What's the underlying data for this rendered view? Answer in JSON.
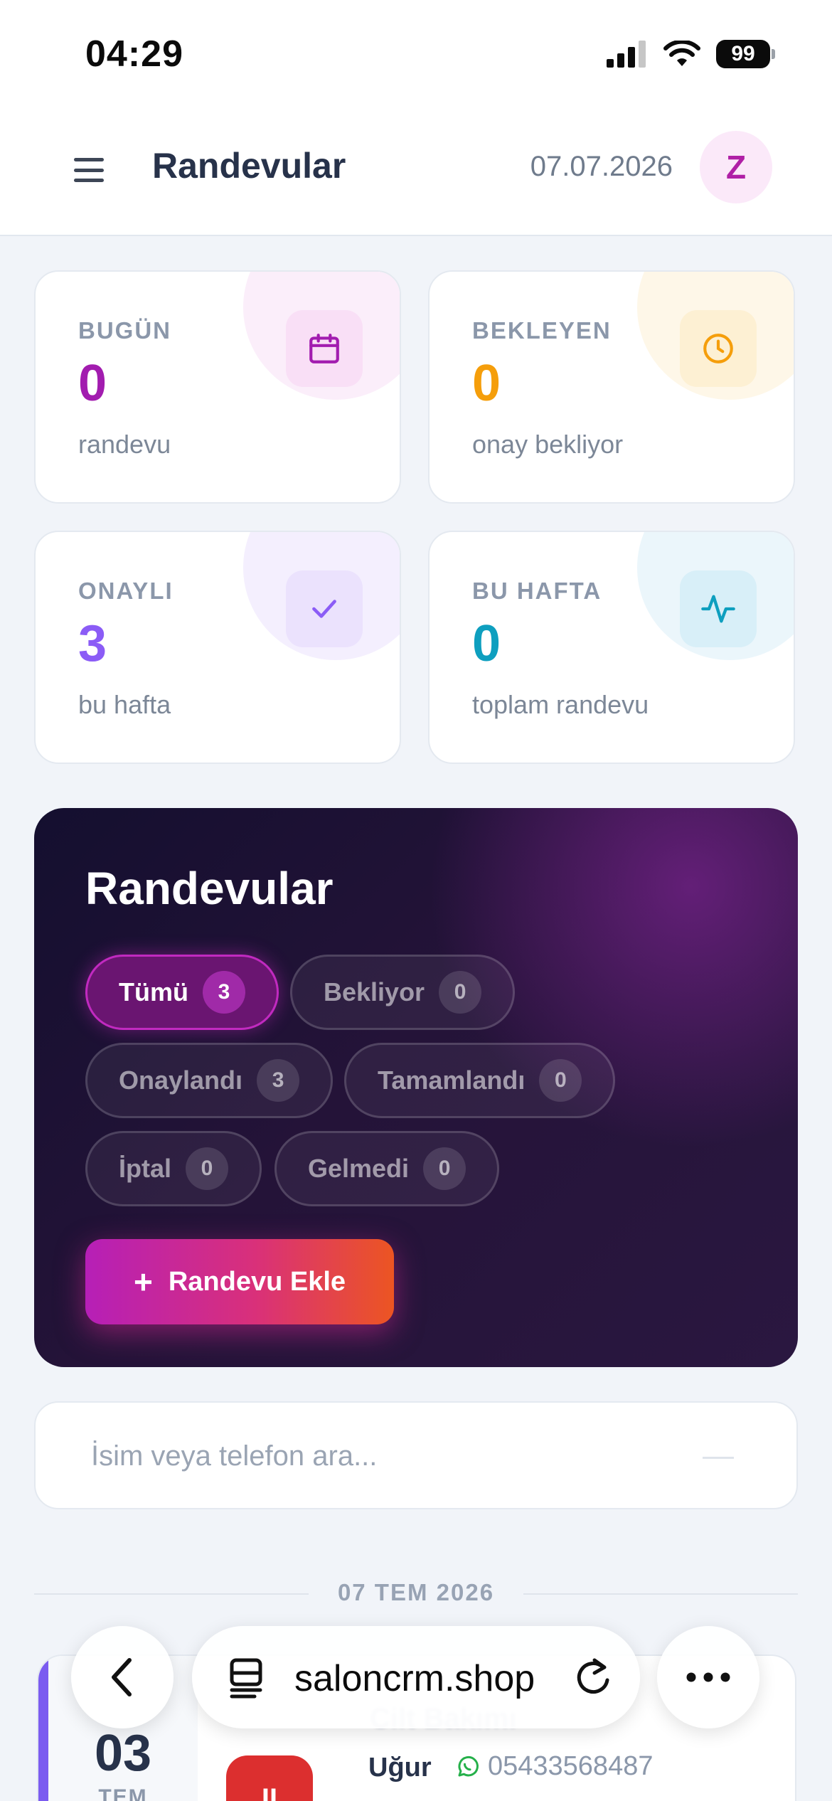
{
  "status_bar": {
    "time": "04:29",
    "battery": "99"
  },
  "header": {
    "title": "Randevular",
    "date": "07.07.2026",
    "avatar_initial": "Z"
  },
  "stats": [
    {
      "label": "BUGÜN",
      "value": "0",
      "sub": "randevu",
      "color": "#a21caf",
      "icon": "calendar-icon"
    },
    {
      "label": "BEKLEYEN",
      "value": "0",
      "sub": "onay bekliyor",
      "color": "#f59e0b",
      "icon": "clock-icon"
    },
    {
      "label": "ONAYLI",
      "value": "3",
      "sub": "bu hafta",
      "color": "#8b5cf6",
      "icon": "check-icon"
    },
    {
      "label": "BU HAFTA",
      "value": "0",
      "sub": "toplam randevu",
      "color": "#0e9fbf",
      "icon": "activity-icon"
    }
  ],
  "panel": {
    "title": "Randevular",
    "filters": [
      {
        "label": "Tümü",
        "count": "3",
        "active": true
      },
      {
        "label": "Bekliyor",
        "count": "0"
      },
      {
        "label": "Onaylandı",
        "count": "3"
      },
      {
        "label": "Tamamlandı",
        "count": "0"
      },
      {
        "label": "İptal",
        "count": "0"
      },
      {
        "label": "Gelmedi",
        "count": "0"
      }
    ],
    "add_button": "Randevu Ekle"
  },
  "search": {
    "placeholder": "İsim veya telefon ara..."
  },
  "date_group": "07 TEM 2026",
  "appointment": {
    "day": "03",
    "month": "TEM",
    "service": "Cilt Bakımı",
    "status_letter": "II",
    "customer": "Uğur",
    "phone": "05433568487"
  },
  "browser": {
    "url": "saloncrm.shop"
  }
}
